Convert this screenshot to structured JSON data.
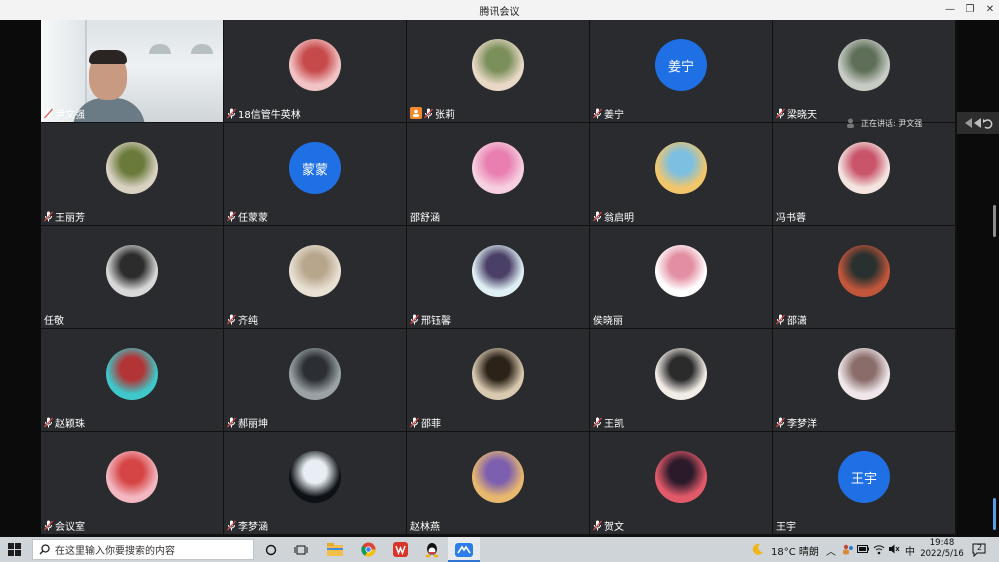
{
  "window": {
    "title": "腾讯会议"
  },
  "speaking": {
    "label": "正在讲话: 尹文强"
  },
  "participants": [
    {
      "name": "尹文强",
      "kind": "video",
      "mic": true
    },
    {
      "name": "18信管牛英林",
      "kind": "photo",
      "colors": [
        "#f2c3c5",
        "#c64a4a"
      ],
      "mic": true
    },
    {
      "name": "张莉",
      "kind": "photo",
      "colors": [
        "#e9d8c6",
        "#7a8f5a"
      ],
      "mic": true,
      "share": true
    },
    {
      "name": "姜宁",
      "kind": "text",
      "avatar_text": "姜宁",
      "mic": true
    },
    {
      "name": "梁晓天",
      "kind": "photo",
      "colors": [
        "#c6cbc4",
        "#5f6e58"
      ],
      "mic": true
    },
    {
      "name": "王丽芳",
      "kind": "photo",
      "colors": [
        "#d9d2c3",
        "#6a7a3a"
      ],
      "mic": true
    },
    {
      "name": "任蒙蒙",
      "kind": "text",
      "avatar_text": "蒙蒙",
      "mic": true
    },
    {
      "name": "邵舒涵",
      "kind": "photo",
      "colors": [
        "#f6cfe0",
        "#e87fb0"
      ],
      "mic": false
    },
    {
      "name": "翁启明",
      "kind": "photo",
      "colors": [
        "#f1c66b",
        "#7dbfe0"
      ],
      "mic": true
    },
    {
      "name": "冯书蓉",
      "kind": "photo",
      "colors": [
        "#f4e4e0",
        "#c9556b"
      ],
      "mic": false
    },
    {
      "name": "任敬",
      "kind": "photo",
      "colors": [
        "#d8d8d8",
        "#2c2c2c"
      ],
      "mic": false
    },
    {
      "name": "齐纯",
      "kind": "photo",
      "colors": [
        "#e9e1d4",
        "#b8a68c"
      ],
      "mic": true
    },
    {
      "name": "邢钰馨",
      "kind": "photo",
      "colors": [
        "#dff0f5",
        "#4a3f66"
      ],
      "mic": true
    },
    {
      "name": "侯晓丽",
      "kind": "photo",
      "colors": [
        "#ffffff",
        "#e38fa3"
      ],
      "mic": false
    },
    {
      "name": "邵潇",
      "kind": "photo",
      "colors": [
        "#c2563a",
        "#28312f"
      ],
      "mic": true
    },
    {
      "name": "赵颖珠",
      "kind": "photo",
      "colors": [
        "#3fc7c9",
        "#b23434"
      ],
      "mic": true
    },
    {
      "name": "郝丽坤",
      "kind": "photo",
      "colors": [
        "#9aa2a6",
        "#2b2f33"
      ],
      "mic": true
    },
    {
      "name": "邵菲",
      "kind": "photo",
      "colors": [
        "#d9c9b0",
        "#2b2318"
      ],
      "mic": true
    },
    {
      "name": "王凯",
      "kind": "photo",
      "colors": [
        "#f2ede7",
        "#2b2b2b"
      ],
      "mic": true
    },
    {
      "name": "李梦洋",
      "kind": "photo",
      "colors": [
        "#efe7ea",
        "#8a6d6b"
      ],
      "mic": true
    },
    {
      "name": "会议室",
      "kind": "photo",
      "colors": [
        "#f2b7c0",
        "#d64545"
      ],
      "mic": true
    },
    {
      "name": "李梦涵",
      "kind": "photo",
      "colors": [
        "#0e1217",
        "#e8eef3"
      ],
      "mic": true
    },
    {
      "name": "赵林燕",
      "kind": "photo",
      "colors": [
        "#e8b86e",
        "#7d5fb0"
      ],
      "mic": false
    },
    {
      "name": "贺文",
      "kind": "photo",
      "colors": [
        "#e25a6a",
        "#2a1a2a"
      ],
      "mic": true
    },
    {
      "name": "王宇",
      "kind": "text",
      "avatar_text": "王宇",
      "mic": false
    }
  ],
  "taskbar": {
    "search_placeholder": "在这里输入你要搜索的内容",
    "weather": "18°C 晴朗",
    "ime": "中",
    "time": "19:48",
    "date": "2022/5/16",
    "notifications": "2"
  }
}
